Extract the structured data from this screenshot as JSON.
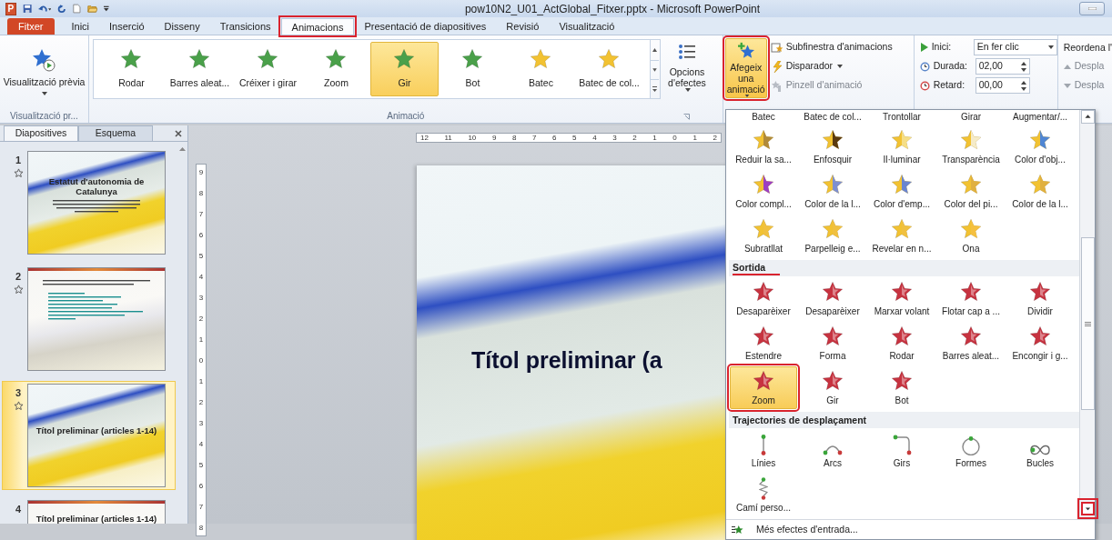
{
  "window": {
    "title": "pow10N2_U01_ActGlobal_Fitxer.pptx - Microsoft PowerPoint",
    "logo_letter": "P"
  },
  "tabs": [
    {
      "label": "Fitxer",
      "kind": "file",
      "selected": false,
      "highlighted": false
    },
    {
      "label": "Inici",
      "kind": "tab",
      "selected": false,
      "highlighted": false
    },
    {
      "label": "Inserció",
      "kind": "tab",
      "selected": false,
      "highlighted": false
    },
    {
      "label": "Disseny",
      "kind": "tab",
      "selected": false,
      "highlighted": false
    },
    {
      "label": "Transicions",
      "kind": "tab",
      "selected": false,
      "highlighted": false
    },
    {
      "label": "Animacions",
      "kind": "tab",
      "selected": true,
      "highlighted": true
    },
    {
      "label": "Presentació de diapositives",
      "kind": "tab",
      "selected": false,
      "highlighted": false
    },
    {
      "label": "Revisió",
      "kind": "tab",
      "selected": false,
      "highlighted": false
    },
    {
      "label": "Visualització",
      "kind": "tab",
      "selected": false,
      "highlighted": false
    }
  ],
  "ribbon": {
    "preview": {
      "label": "Visualització prèvia",
      "group_label": "Visualització pr..."
    },
    "gallery": {
      "group_label": "Animació",
      "items": [
        {
          "label": "Rodar",
          "selected": false
        },
        {
          "label": "Barres aleat...",
          "selected": false
        },
        {
          "label": "Créixer i girar",
          "selected": false
        },
        {
          "label": "Zoom",
          "selected": false
        },
        {
          "label": "Gir",
          "selected": true
        },
        {
          "label": "Bot",
          "selected": false
        },
        {
          "label": "Batec",
          "selected": false
        },
        {
          "label": "Batec de col...",
          "selected": false
        }
      ]
    },
    "effect_options": {
      "label": "Opcions d'efectes"
    },
    "add_animation": {
      "label": "Afegeix una animació",
      "highlighted": true
    },
    "advanced": [
      {
        "label": "Subfinestra d'animacions",
        "disabled": false,
        "dropdown": false
      },
      {
        "label": "Disparador",
        "disabled": false,
        "dropdown": true
      },
      {
        "label": "Pinzell d'animació",
        "disabled": true,
        "dropdown": false
      }
    ],
    "timing": [
      {
        "label": "Inici:",
        "value": "En fer clic",
        "kind": "dropdown"
      },
      {
        "label": "Durada:",
        "value": "02,00",
        "kind": "spinner"
      },
      {
        "label": "Retard:",
        "value": "00,00",
        "kind": "spinner"
      }
    ],
    "reorder": {
      "label": "Reordena l'",
      "items": [
        {
          "label": "Despla",
          "disabled": true
        },
        {
          "label": "Despla",
          "disabled": true
        }
      ]
    }
  },
  "slides_pane": {
    "tabs": [
      {
        "label": "Diapositives",
        "selected": true
      },
      {
        "label": "Esquema",
        "selected": false
      }
    ],
    "slides": [
      {
        "number": "1",
        "kind": "title",
        "title": "Estatut d'autonomia de Catalunya",
        "selected": false
      },
      {
        "number": "2",
        "kind": "list",
        "selected": false
      },
      {
        "number": "3",
        "kind": "section",
        "title": "Títol preliminar (articles 1-14)",
        "selected": true
      },
      {
        "number": "4",
        "kind": "content",
        "title": "Títol preliminar (articles 1-14)",
        "selected": false
      }
    ]
  },
  "editor": {
    "h_ruler": [
      "12",
      "11",
      "10",
      "9",
      "8",
      "7",
      "6",
      "5",
      "4",
      "3",
      "2",
      "1",
      "0",
      "1",
      "2"
    ],
    "v_ruler": [
      "9",
      "8",
      "7",
      "6",
      "5",
      "4",
      "3",
      "2",
      "1",
      "0",
      "1",
      "2",
      "3",
      "4",
      "5",
      "6",
      "7",
      "8"
    ],
    "slide_title": "Títol preliminar (a"
  },
  "dropdown": {
    "clipped_labels": [
      "Batec",
      "Batec de col...",
      "Trontollar",
      "Girar",
      "Augmentar/..."
    ],
    "sections": [
      {
        "kind": "emphasis",
        "items": [
          {
            "label": "Reduir la sa...",
            "selected": false,
            "highlighted": false
          },
          {
            "label": "Enfosquir",
            "selected": false,
            "highlighted": false
          },
          {
            "label": "Il·luminar",
            "selected": false,
            "highlighted": false
          },
          {
            "label": "Transparència",
            "selected": false,
            "highlighted": false
          },
          {
            "label": "Color d'obj...",
            "selected": false,
            "highlighted": false
          },
          {
            "label": "Color compl...",
            "selected": false,
            "highlighted": false
          },
          {
            "label": "Color de la l...",
            "selected": false,
            "highlighted": false
          },
          {
            "label": "Color d'emp...",
            "selected": false,
            "highlighted": false
          },
          {
            "label": "Color del pi...",
            "selected": false,
            "highlighted": false
          },
          {
            "label": "Color de la l...",
            "selected": false,
            "highlighted": false
          },
          {
            "label": "Subratllat",
            "selected": false,
            "highlighted": false
          },
          {
            "label": "Parpelleig e...",
            "selected": false,
            "highlighted": false
          },
          {
            "label": "Revelar en n...",
            "selected": false,
            "highlighted": false
          },
          {
            "label": "Ona",
            "selected": false,
            "highlighted": false
          }
        ]
      },
      {
        "kind": "exit",
        "header": "Sortida",
        "underlined": true,
        "items": [
          {
            "label": "Desaparèixer",
            "selected": false,
            "highlighted": false
          },
          {
            "label": "Desaparèixer",
            "selected": false,
            "highlighted": false
          },
          {
            "label": "Marxar volant",
            "selected": false,
            "highlighted": false
          },
          {
            "label": "Flotar cap a ...",
            "selected": false,
            "highlighted": false
          },
          {
            "label": "Dividir",
            "selected": false,
            "highlighted": false
          },
          {
            "label": "Estendre",
            "selected": false,
            "highlighted": false
          },
          {
            "label": "Forma",
            "selected": false,
            "highlighted": false
          },
          {
            "label": "Rodar",
            "selected": false,
            "highlighted": false
          },
          {
            "label": "Barres aleat...",
            "selected": false,
            "highlighted": false
          },
          {
            "label": "Encongir i g...",
            "selected": false,
            "highlighted": false
          },
          {
            "label": "Zoom",
            "selected": true,
            "highlighted": true
          },
          {
            "label": "Gir",
            "selected": false,
            "highlighted": false
          },
          {
            "label": "Bot",
            "selected": false,
            "highlighted": false
          }
        ]
      },
      {
        "kind": "path",
        "header": "Trajectories de desplaçament",
        "underlined": false,
        "items": [
          {
            "label": "Línies",
            "selected": false,
            "highlighted": false
          },
          {
            "label": "Arcs",
            "selected": false,
            "highlighted": false
          },
          {
            "label": "Girs",
            "selected": false,
            "highlighted": false
          },
          {
            "label": "Formes",
            "selected": false,
            "highlighted": false
          },
          {
            "label": "Bucles",
            "selected": false,
            "highlighted": false
          },
          {
            "label": "Camí perso...",
            "selected": false,
            "highlighted": false
          }
        ]
      }
    ],
    "scrollbar": {
      "down_highlighted": true
    },
    "footer": "Més efectes d'entrada..."
  }
}
